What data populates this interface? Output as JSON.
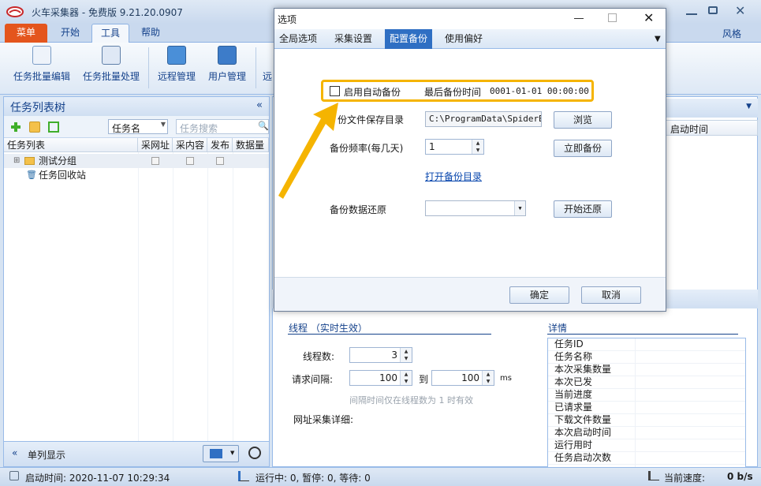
{
  "app": {
    "title": "火车采集器 - 免费版 9.21.20.0907",
    "style_label": "风格",
    "colors": {
      "accent": "#2f6fc3",
      "menu_tab": "#e4551d",
      "highlight": "#f5b400"
    }
  },
  "ribbon": {
    "tabs": [
      "菜单",
      "开始",
      "工具",
      "帮助"
    ],
    "active_tab": "工具",
    "buttons": [
      "任务批量编辑",
      "任务批量处理",
      "远程管理",
      "用户管理",
      "远"
    ]
  },
  "left_panel": {
    "title": "任务列表树",
    "select_value": "任务名",
    "search_placeholder": "任务搜索",
    "columns": [
      "任务列表",
      "采网址",
      "采内容",
      "发布",
      "数据量"
    ],
    "rows": [
      {
        "name": "测试分组"
      },
      {
        "name": "任务回收站"
      }
    ],
    "bottom_label": "单列显示"
  },
  "right_panel": {
    "column_header": "启动时间",
    "thread_title": "线程 （实时生效）",
    "thread_label": "线程数:",
    "thread_value": "3",
    "interval_label": "请求间隔:",
    "interval_from": "100",
    "interval_to_label": "到",
    "interval_to": "100",
    "interval_unit": "ms",
    "interval_note": "间隔时间仅在线程数为 1 时有效",
    "url_detail_label": "网址采集详细:",
    "details_title": "详情",
    "details_rows": [
      "任务ID",
      "任务名称",
      "本次采集数量",
      "本次已发",
      "当前进度",
      "已请求量",
      "下载文件数量",
      "本次启动时间",
      "运行用时",
      "任务启动次数"
    ]
  },
  "status": {
    "start_time": "启动时间: 2020-11-07 10:29:34",
    "run_status": "运行中: 0, 暂停: 0, 等待: 0",
    "speed_label": "当前速度:",
    "speed_value": "0 b/s"
  },
  "dialog": {
    "title": "选项",
    "tabs": [
      "全局选项",
      "采集设置",
      "配置备份",
      "使用偏好"
    ],
    "active_tab": "配置备份",
    "auto_backup_label": "启用自动备份",
    "auto_backup_checked": false,
    "last_backup_label": "最后备份时间",
    "last_backup_value": "0001-01-01 00:00:00",
    "save_dir_label": "份文件保存目录",
    "save_dir_value": "C:\\ProgramData\\SpiderBac",
    "browse_button": "浏览",
    "frequency_label": "备份频率(每几天)",
    "frequency_value": "1",
    "backup_now_button": "立即备份",
    "open_dir_link": "打开备份目录",
    "restore_label": "备份数据还原",
    "restore_value": "",
    "restore_button": "开始还原",
    "ok_button": "确定",
    "cancel_button": "取消"
  }
}
